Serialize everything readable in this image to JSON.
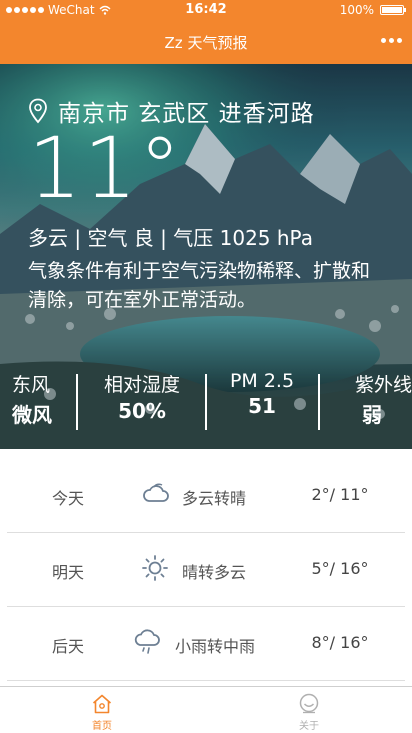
{
  "status_bar": {
    "carrier": "WeChat",
    "time": "16:42",
    "battery": "100%"
  },
  "nav": {
    "title": "Zz 天气预报"
  },
  "current": {
    "location": "南京市 玄武区 进香河路",
    "temperature": "11°",
    "summary": "多云 | 空气 良 | 气压 1025 hPa",
    "advice": "气象条件有利于空气污染物稀释、扩散和清除，可在室外正常活动。"
  },
  "metrics": [
    {
      "label": "东风",
      "value": "微风"
    },
    {
      "label": "相对湿度",
      "value": "50%"
    },
    {
      "label": "PM 2.5",
      "value": "51"
    },
    {
      "label": "紫外线",
      "value": "弱"
    }
  ],
  "forecast": [
    {
      "day": "今天",
      "icon": "cloudy-icon",
      "condition": "多云转晴",
      "range": "2°/ 11°"
    },
    {
      "day": "明天",
      "icon": "sunny-icon",
      "condition": "晴转多云",
      "range": "5°/ 16°"
    },
    {
      "day": "后天",
      "icon": "rain-icon",
      "condition": "小雨转中雨",
      "range": "8°/ 16°"
    }
  ],
  "tabs": [
    {
      "label": "首页",
      "icon": "home-icon",
      "active": true
    },
    {
      "label": "关于",
      "icon": "smiley-icon",
      "active": false
    }
  ],
  "colors": {
    "brand": "#f3862d",
    "tab_active": "#f3862d",
    "tab_inactive": "#b0b0b0"
  }
}
